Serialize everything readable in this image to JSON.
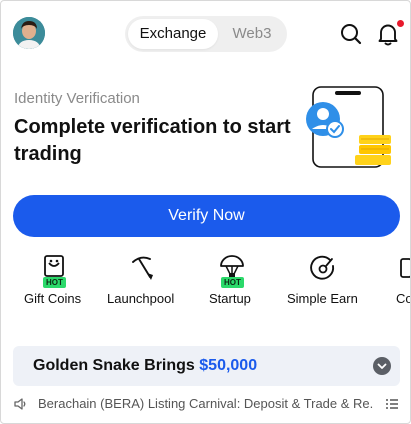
{
  "header": {
    "tabs": [
      {
        "label": "Exchange",
        "active": true
      },
      {
        "label": "Web3",
        "active": false
      }
    ],
    "icons": [
      "search-icon",
      "bell-icon"
    ],
    "notification_dot_color": "#e8192c"
  },
  "hero": {
    "subtitle": "Identity Verification",
    "title": "Complete verification to start trading",
    "button_label": "Verify Now",
    "button_color": "#1b5bec"
  },
  "shortcuts": [
    {
      "label": "Gift Coins",
      "icon": "gift-card-icon",
      "badge": "HOT"
    },
    {
      "label": "Launchpool",
      "icon": "pickaxe-icon",
      "badge": ""
    },
    {
      "label": "Startup",
      "icon": "parachute-icon",
      "badge": "HOT"
    },
    {
      "label": "Simple Earn",
      "icon": "earn-icon",
      "badge": ""
    },
    {
      "label": "Co",
      "icon": "copy-trading-icon",
      "badge": ""
    }
  ],
  "banner": {
    "title_prefix": "Golden Snake Brings ",
    "amount": "$50,000",
    "amount_color": "#1b5bec"
  },
  "ticker": {
    "text": "Berachain (BERA) Listing Carnival: Deposit & Trade & Re..."
  }
}
